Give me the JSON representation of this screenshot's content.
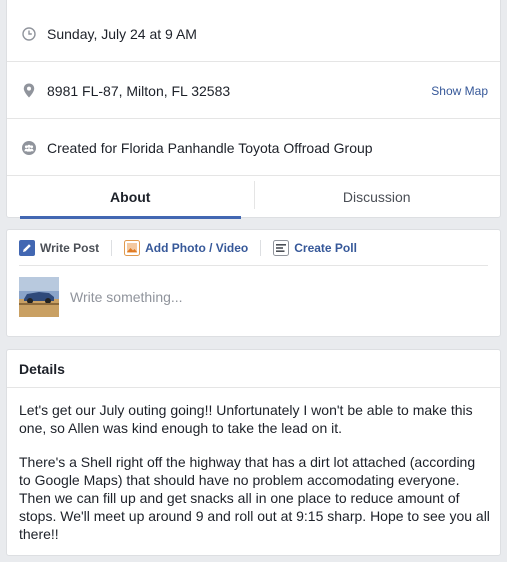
{
  "event_info": {
    "datetime": "Sunday, July 24 at 9 AM",
    "location": "8981 FL-87, Milton, FL 32583",
    "show_map_label": "Show Map",
    "created_for": "Created for Florida Panhandle Toyota Offroad Group"
  },
  "tabs": [
    {
      "label": "About",
      "active": true
    },
    {
      "label": "Discussion",
      "active": false
    }
  ],
  "composer": {
    "actions": [
      {
        "label": "Write Post",
        "icon": "pencil-icon",
        "active": true
      },
      {
        "label": "Add Photo / Video",
        "icon": "photo-icon",
        "active": false
      },
      {
        "label": "Create Poll",
        "icon": "poll-icon",
        "active": false
      }
    ],
    "placeholder": "Write something..."
  },
  "details": {
    "title": "Details",
    "paragraphs": [
      "Let's get our July outing going!! Unfortunately I won't be able to make this one, so Allen was kind enough to take the lead on it.",
      "There's a Shell right off the highway that has a dirt lot attached (according to Google Maps) that should have no problem accomodating everyone. Then we can fill up and get snacks all in one place to reduce amount of stops. We'll meet up around 9 and roll out at 9:15 sharp. Hope to see you all there!!"
    ]
  },
  "colors": {
    "accent": "#4267b2",
    "link": "#365899",
    "background": "#e9ebee"
  }
}
